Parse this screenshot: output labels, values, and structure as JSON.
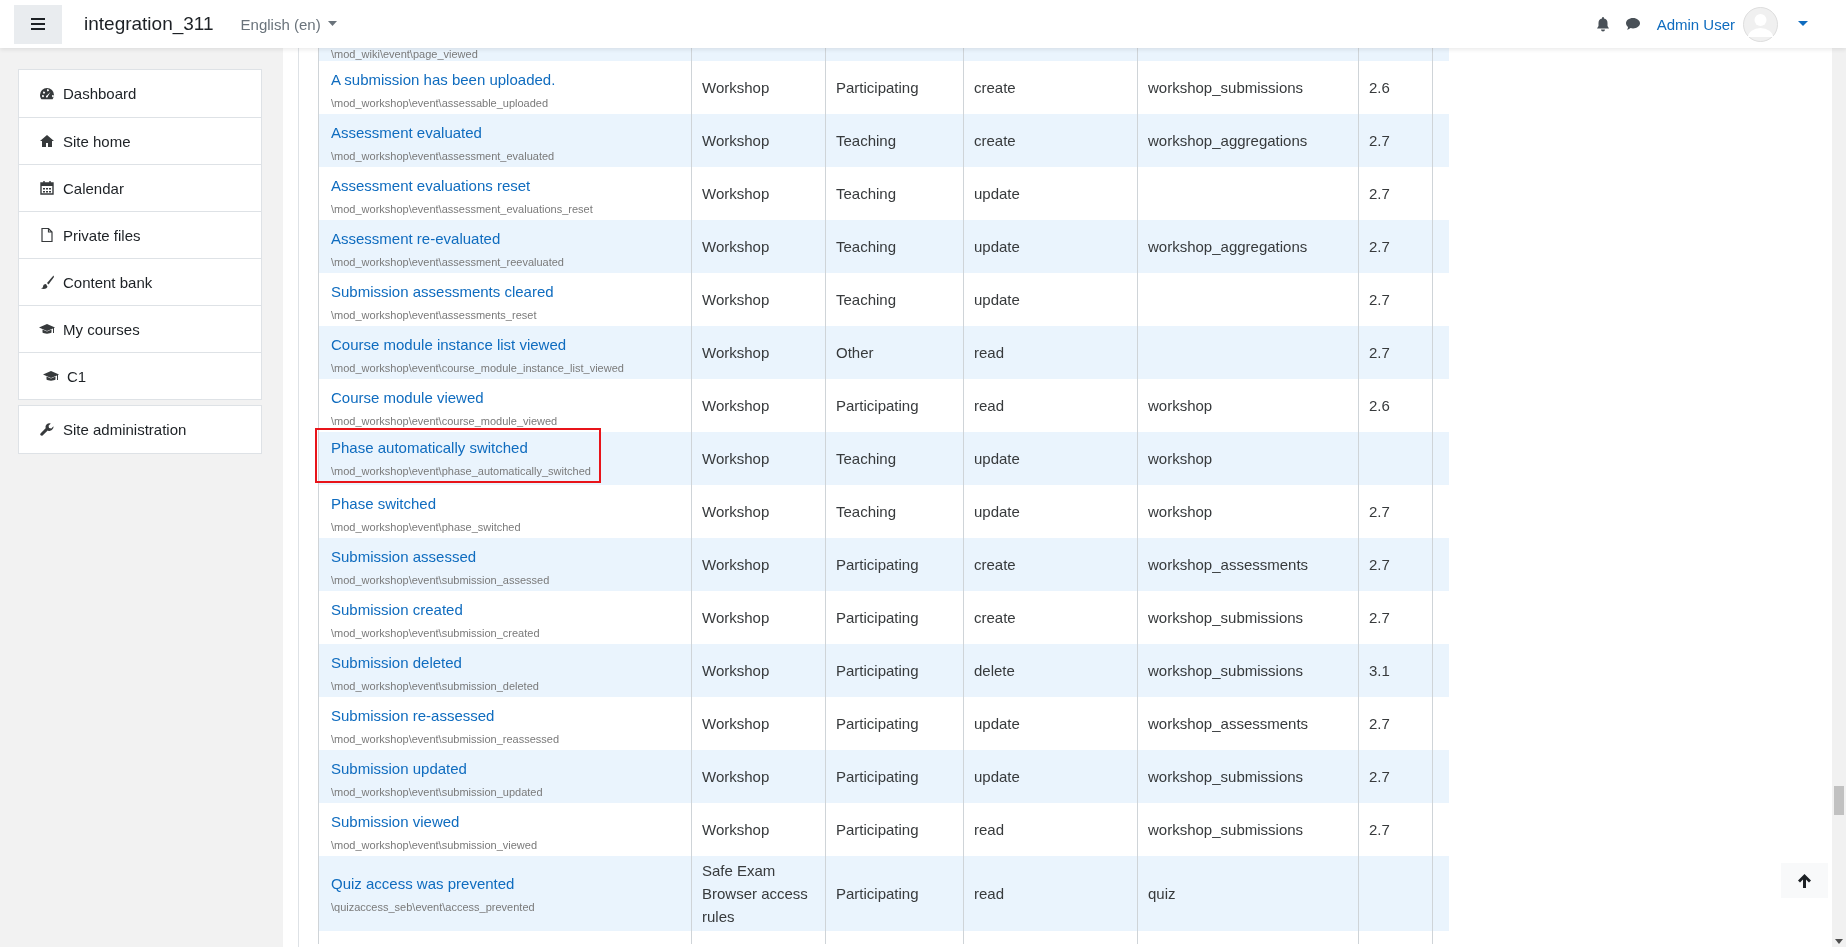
{
  "navbar": {
    "site_name": "integration_311",
    "language": "English (en)",
    "user_name": "Admin User"
  },
  "sidebar": {
    "groups": [
      {
        "items": [
          {
            "label": "Dashboard"
          },
          {
            "label": "Site home"
          },
          {
            "label": "Calendar"
          },
          {
            "label": "Private files"
          },
          {
            "label": "Content bank"
          },
          {
            "label": "My courses",
            "children": [
              {
                "label": "C1"
              }
            ]
          }
        ]
      },
      {
        "items": [
          {
            "label": "Site administration"
          }
        ]
      }
    ]
  },
  "table": {
    "rows": [
      {
        "kind": "clipped",
        "path": "\\mod_wiki\\event\\page_viewed"
      },
      {
        "kind": "event",
        "title": "A submission has been uploaded.",
        "path": "\\mod_workshop\\event\\assessable_uploaded",
        "column_2": "Workshop",
        "column_3": "Participating",
        "column_4": "create",
        "column_5": "workshop_submissions",
        "column_6": "2.6",
        "highlighted": false
      },
      {
        "kind": "event",
        "title": "Assessment evaluated",
        "path": "\\mod_workshop\\event\\assessment_evaluated",
        "column_2": "Workshop",
        "column_3": "Teaching",
        "column_4": "create",
        "column_5": "workshop_aggregations",
        "column_6": "2.7",
        "highlighted": false
      },
      {
        "kind": "event",
        "title": "Assessment evaluations reset",
        "path": "\\mod_workshop\\event\\assessment_evaluations_reset",
        "column_2": "Workshop",
        "column_3": "Teaching",
        "column_4": "update",
        "column_6": "2.7",
        "highlighted": false
      },
      {
        "kind": "event",
        "title": "Assessment re-evaluated",
        "path": "\\mod_workshop\\event\\assessment_reevaluated",
        "column_2": "Workshop",
        "column_3": "Teaching",
        "column_4": "update",
        "column_5": "workshop_aggregations",
        "column_6": "2.7",
        "highlighted": false
      },
      {
        "kind": "event",
        "title": "Submission assessments cleared",
        "path": "\\mod_workshop\\event\\assessments_reset",
        "column_2": "Workshop",
        "column_3": "Teaching",
        "column_4": "update",
        "column_6": "2.7",
        "highlighted": false
      },
      {
        "kind": "event",
        "title": "Course module instance list viewed",
        "path": "\\mod_workshop\\event\\course_module_instance_list_viewed",
        "column_2": "Workshop",
        "column_3": "Other",
        "column_4": "read",
        "column_6": "2.7",
        "highlighted": false
      },
      {
        "kind": "event",
        "title": "Course module viewed",
        "path": "\\mod_workshop\\event\\course_module_viewed",
        "column_2": "Workshop",
        "column_3": "Participating",
        "column_4": "read",
        "column_5": "workshop",
        "column_6": "2.6",
        "highlighted": false
      },
      {
        "kind": "event",
        "title": "Phase automatically switched",
        "path": "\\mod_workshop\\event\\phase_automatically_switched",
        "column_2": "Workshop",
        "column_3": "Teaching",
        "column_4": "update",
        "column_5": "workshop",
        "highlighted": true
      },
      {
        "kind": "event",
        "title": "Phase switched",
        "path": "\\mod_workshop\\event\\phase_switched",
        "column_2": "Workshop",
        "column_3": "Teaching",
        "column_4": "update",
        "column_5": "workshop",
        "column_6": "2.7",
        "highlighted": false
      },
      {
        "kind": "event",
        "title": "Submission assessed",
        "path": "\\mod_workshop\\event\\submission_assessed",
        "column_2": "Workshop",
        "column_3": "Participating",
        "column_4": "create",
        "column_5": "workshop_assessments",
        "column_6": "2.7",
        "highlighted": false
      },
      {
        "kind": "event",
        "title": "Submission created",
        "path": "\\mod_workshop\\event\\submission_created",
        "column_2": "Workshop",
        "column_3": "Participating",
        "column_4": "create",
        "column_5": "workshop_submissions",
        "column_6": "2.7",
        "highlighted": false
      },
      {
        "kind": "event",
        "title": "Submission deleted",
        "path": "\\mod_workshop\\event\\submission_deleted",
        "column_2": "Workshop",
        "column_3": "Participating",
        "column_4": "delete",
        "column_5": "workshop_submissions",
        "column_6": "3.1",
        "highlighted": false
      },
      {
        "kind": "event",
        "title": "Submission re-assessed",
        "path": "\\mod_workshop\\event\\submission_reassessed",
        "column_2": "Workshop",
        "column_3": "Participating",
        "column_4": "update",
        "column_5": "workshop_assessments",
        "column_6": "2.7",
        "highlighted": false
      },
      {
        "kind": "event",
        "title": "Submission updated",
        "path": "\\mod_workshop\\event\\submission_updated",
        "column_2": "Workshop",
        "column_3": "Participating",
        "column_4": "update",
        "column_5": "workshop_submissions",
        "column_6": "2.7",
        "highlighted": false
      },
      {
        "kind": "event",
        "title": "Submission viewed",
        "path": "\\mod_workshop\\event\\submission_viewed",
        "column_2": "Workshop",
        "column_3": "Participating",
        "column_4": "read",
        "column_5": "workshop_submissions",
        "column_6": "2.7",
        "highlighted": false
      },
      {
        "kind": "event",
        "title": "Quiz access was prevented",
        "path": "\\quizaccess_seb\\event\\access_prevented",
        "column_2": "Safe Exam Browser access rules",
        "column_3": "Participating",
        "column_4": "read",
        "column_5": "quiz",
        "highlighted": false
      },
      {
        "kind": "clipped"
      }
    ]
  }
}
